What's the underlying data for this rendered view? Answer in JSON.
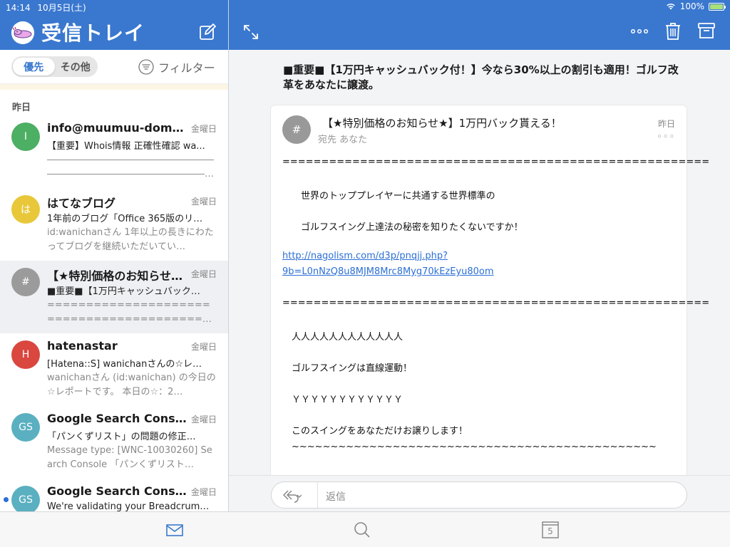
{
  "status": {
    "time": "14:14",
    "date": "10月5日(土)",
    "battery": "100%"
  },
  "sidebar": {
    "title": "受信トレイ",
    "segments": [
      {
        "label": "優先",
        "active": true
      },
      {
        "label": "その他",
        "active": false
      }
    ],
    "filter_label": "フィルター",
    "section_label": "昨日",
    "mails": [
      {
        "avatar": "I",
        "avatar_color": "#4caf63",
        "sender": "info@muumuu-domain....",
        "date": "金曜日",
        "subject": "【重要】Whois情報 正確性確認 wa...",
        "preview": "――――――――――――――――――――――――――――――――――――――…",
        "selected": false,
        "unread": false
      },
      {
        "avatar": "は",
        "avatar_color": "#e8c83a",
        "sender": "はてなブログ",
        "date": "金曜日",
        "subject": "1年前のブログ「Office 365版のリ…",
        "preview": "id:wanichanさん 1年以上の長きにわたってブログを継続いただいてい…",
        "selected": false,
        "unread": false
      },
      {
        "avatar": "#",
        "avatar_color": "#9b9b9b",
        "sender": "【★特別価格のお知らせ…",
        "date": "金曜日",
        "subject": "■重要■【1万円キャッシュバック…",
        "preview": "====================================================…",
        "selected": true,
        "unread": false
      },
      {
        "avatar": "H",
        "avatar_color": "#d9473f",
        "sender": "hatenastar",
        "date": "金曜日",
        "subject": "[Hatena::S] wanichanさんの☆レ…",
        "preview": "wanichanさん (id:wanichan) の今日の☆レポートです。 本日の☆：2…",
        "selected": false,
        "unread": false
      },
      {
        "avatar": "GS",
        "avatar_color": "#5ab0c0",
        "sender": "Google Search Console...",
        "date": "金曜日",
        "subject": "「パンくずリスト」の問題の修正…",
        "preview": "Message type: [WNC-10030260] Search Console 「パンくずリスト…",
        "selected": false,
        "unread": false
      },
      {
        "avatar": "GS",
        "avatar_color": "#5ab0c0",
        "sender": "Google Search Console...",
        "date": "金曜日",
        "subject": "We're validating your Breadcrum…",
        "preview": "",
        "selected": false,
        "unread": true
      }
    ]
  },
  "reading": {
    "thread_subject": "■重要■【1万円キャッシュバック付！】今なら30%以上の割引も適用！ゴルフ改革をあなたに譲渡。",
    "avatar": "#",
    "message_subject": "【★特別価格のお知らせ★】1万円バック貰える！",
    "recipient": "宛先 あなた",
    "date": "昨日",
    "more": "◦◦◦",
    "body_lines": [
      "=======================================================",
      "　　世界のトッププレイヤーに共通する世界標準の",
      "　　ゴルフスイング上達法の秘密を知りたくないですか！",
      "http://nagolism.com/d3p/pnqjj.php?",
      "9b=L0nNzQ8u8MJM8Mrc8Myg70kEzEyu80om",
      "=======================================================",
      "　人人人人人人人人人人人人",
      "　ゴルフスイングは直線運動！",
      "　ＹＹＹＹＹＹＹＹＹＹＹＹ",
      "　このスイングをあなただけお譲りします！",
      "　~~~~~~~~~~~~~~~~~~~~~~~~~~~~~~~~~~~~~~~~~~~~~~~"
    ]
  },
  "reply": {
    "placeholder": "返信"
  },
  "tabbar": {
    "calendar_day": "5"
  },
  "colors": {
    "brand_blue": "#3a78cf",
    "link_blue": "#2b6fd6"
  }
}
